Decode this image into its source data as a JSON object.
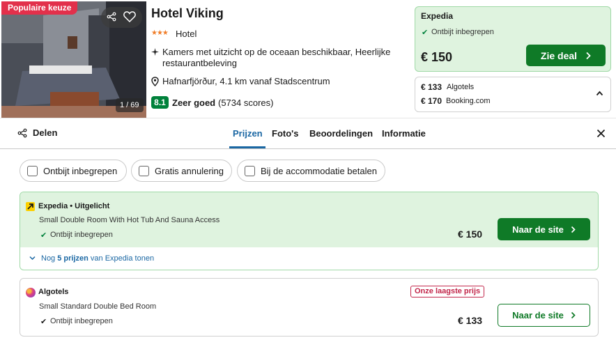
{
  "hotel": {
    "badge": "Populaire keuze",
    "photo_count": "1 / 69",
    "name": "Hotel Viking",
    "stars": "★★★",
    "type": "Hotel",
    "amenities": "Kamers met uitzicht op de oceaan beschikbaar, Heerlijke restaurantbeleving",
    "location": "Hafnarfjörður, 4.1 km vanaf Stadscentrum",
    "score": "8.1",
    "score_word": "Zeer goed",
    "score_count": "(5734 scores)"
  },
  "top_deal": {
    "provider": "Expedia",
    "breakfast": "Ontbijt inbegrepen",
    "price": "€ 150",
    "button": "Zie deal"
  },
  "other_deals": [
    {
      "price": "€ 133",
      "provider": "Algotels"
    },
    {
      "price": "€ 170",
      "provider": "Booking.com"
    }
  ],
  "tabs": {
    "share": "Delen",
    "items": [
      "Prijzen",
      "Foto's",
      "Beoordelingen",
      "Informatie"
    ]
  },
  "filters": [
    "Ontbijt inbegrepen",
    "Gratis annulering",
    "Bij de accommodatie betalen"
  ],
  "offers": [
    {
      "provider": "Expedia • Uitgelicht",
      "room": "Small Double Room With Hot Tub And Sauna Access",
      "breakfast": "Ontbijt inbegrepen",
      "price": "€ 150",
      "button": "Naar de site",
      "more_prefix": "Nog ",
      "more_bold": "5 prijzen",
      "more_suffix": " van Expedia tonen"
    },
    {
      "provider": "Algotels",
      "room": "Small Standard Double Bed Room",
      "breakfast": "Ontbijt inbegrepen",
      "badge": "Onze laagste prijs",
      "price": "€ 133",
      "button": "Naar de site"
    }
  ],
  "colors": {
    "accent_green": "#0f7a27",
    "deal_bg": "#dff3df",
    "link_blue": "#1a67a3",
    "popular_red": "#e2304b",
    "score_green": "#00813b"
  },
  "icons": [
    "share-icon",
    "heart-icon",
    "sparkle-icon",
    "location-pin-icon",
    "check-icon",
    "chevron-right-icon",
    "chevron-up-icon",
    "close-icon",
    "chevron-down-icon"
  ]
}
